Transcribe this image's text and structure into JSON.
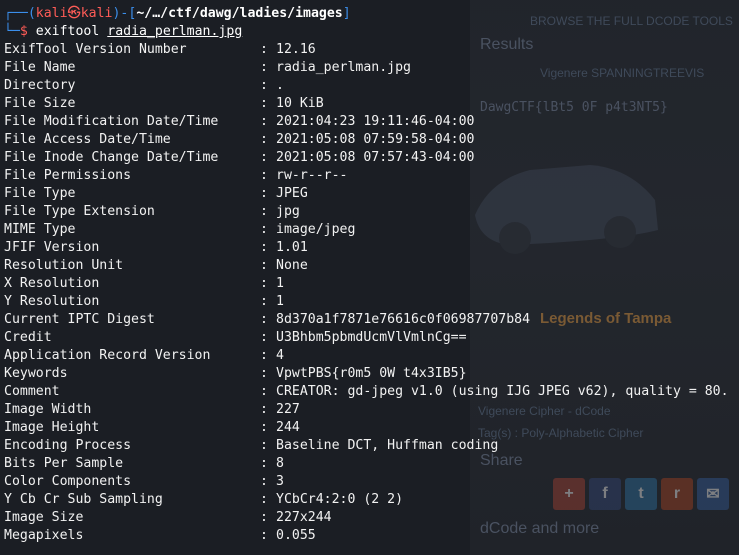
{
  "background": {
    "results_heading": "Results",
    "browse_text": "BROWSE THE FULL DCODE TOOLS",
    "vigenere_label": "Vigenere",
    "vigenere_value": "SPANNINGTREEVIS",
    "flag_text": "DawgCTF{lBt5 0F p4t3NT5}",
    "tampa_heading": "Legends of Tampa",
    "cipher_line": "Vigenere Cipher - dCode",
    "tag_line": "Tag(s) : Poly-Alphabetic Cipher",
    "share_heading": "Share",
    "more_heading": "dCode and more",
    "colors": {
      "share_plus": "#d14836",
      "share_fb": "#3b5998",
      "share_tw": "#1da1f2",
      "share_reddit": "#ff4500",
      "share_mail": "#3b6fb6"
    }
  },
  "terminal": {
    "prompt": {
      "user": "kali",
      "at_symbol": "㉿",
      "host": "kali",
      "path": "~/…/ctf/dawg/ladies/images",
      "command": "exiftool",
      "argument": "radia_perlman.jpg"
    },
    "rows": [
      {
        "tag": "ExifTool Version Number",
        "value": "12.16"
      },
      {
        "tag": "File Name",
        "value": "radia_perlman.jpg"
      },
      {
        "tag": "Directory",
        "value": "."
      },
      {
        "tag": "File Size",
        "value": "10 KiB"
      },
      {
        "tag": "File Modification Date/Time",
        "value": "2021:04:23 19:11:46-04:00"
      },
      {
        "tag": "File Access Date/Time",
        "value": "2021:05:08 07:59:58-04:00"
      },
      {
        "tag": "File Inode Change Date/Time",
        "value": "2021:05:08 07:57:43-04:00"
      },
      {
        "tag": "File Permissions",
        "value": "rw-r--r--"
      },
      {
        "tag": "File Type",
        "value": "JPEG"
      },
      {
        "tag": "File Type Extension",
        "value": "jpg"
      },
      {
        "tag": "MIME Type",
        "value": "image/jpeg"
      },
      {
        "tag": "JFIF Version",
        "value": "1.01"
      },
      {
        "tag": "Resolution Unit",
        "value": "None"
      },
      {
        "tag": "X Resolution",
        "value": "1"
      },
      {
        "tag": "Y Resolution",
        "value": "1"
      },
      {
        "tag": "Current IPTC Digest",
        "value": "8d370a1f7871e76616c0f06987707b84"
      },
      {
        "tag": "Credit",
        "value": "U3Bhbm5pbmdUcmVlVmlnCg=="
      },
      {
        "tag": "Application Record Version",
        "value": "4"
      },
      {
        "tag": "Keywords",
        "value": "VpwtPBS{r0m5 0W t4x3IB5}"
      },
      {
        "tag": "Comment",
        "value": "CREATOR: gd-jpeg v1.0 (using IJG JPEG v62), quality = 80."
      },
      {
        "tag": "Image Width",
        "value": "227"
      },
      {
        "tag": "Image Height",
        "value": "244"
      },
      {
        "tag": "Encoding Process",
        "value": "Baseline DCT, Huffman coding"
      },
      {
        "tag": "Bits Per Sample",
        "value": "8"
      },
      {
        "tag": "Color Components",
        "value": "3"
      },
      {
        "tag": "Y Cb Cr Sub Sampling",
        "value": "YCbCr4:2:0 (2 2)"
      },
      {
        "tag": "Image Size",
        "value": "227x244"
      },
      {
        "tag": "Megapixels",
        "value": "0.055"
      }
    ]
  }
}
